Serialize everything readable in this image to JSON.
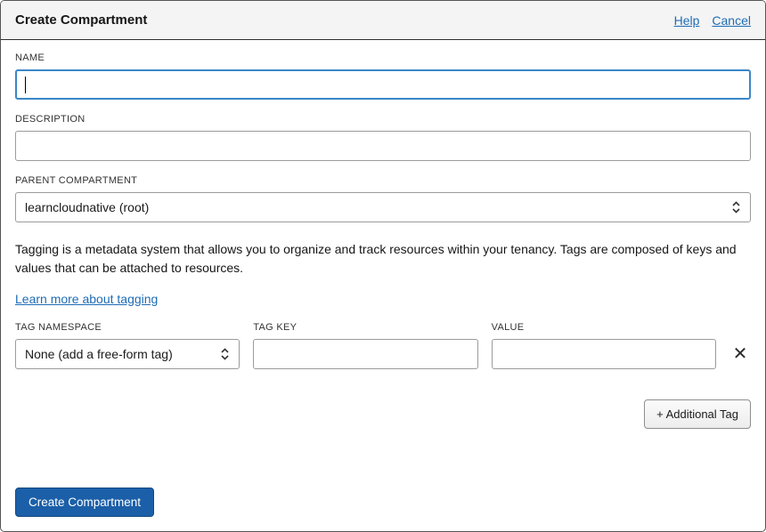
{
  "header": {
    "title": "Create Compartment",
    "help": "Help",
    "cancel": "Cancel"
  },
  "fields": {
    "name": {
      "label": "NAME",
      "value": ""
    },
    "description": {
      "label": "DESCRIPTION",
      "value": ""
    },
    "parent": {
      "label": "PARENT COMPARTMENT",
      "value": "learncloudnative (root)"
    }
  },
  "tagging": {
    "description": "Tagging is a metadata system that allows you to organize and track resources within your tenancy. Tags are composed of keys and values that can be attached to resources.",
    "link": "Learn more about tagging"
  },
  "tags": {
    "namespace": {
      "label": "TAG NAMESPACE",
      "value": "None (add a free-form tag)"
    },
    "key": {
      "label": "TAG KEY",
      "value": ""
    },
    "value": {
      "label": "VALUE",
      "value": ""
    },
    "remove": "✕",
    "additional_button": "+ Additional Tag"
  },
  "footer": {
    "submit": "Create Compartment"
  },
  "colors": {
    "primary": "#1b5fa8",
    "focus_border": "#3a87c8",
    "link": "#1f6cb5"
  }
}
